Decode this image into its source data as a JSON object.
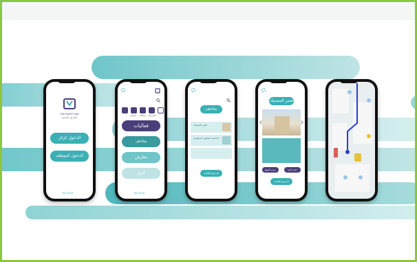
{
  "colors": {
    "frame": "#8cc63f",
    "teal": "#3ab0b5",
    "teal_light": "#b8e1e2",
    "purple": "#4a3f7a",
    "band": "#7ccccf"
  },
  "phone1": {
    "logo_name": "THE RIGHT WAY",
    "logo_sub": "الطريق الصحيح",
    "btn_visitor": "الدخول كزائر",
    "btn_employee": "الدخول كموظف",
    "footer": "RR 2016"
  },
  "phone2": {
    "categories": [
      "أسواق",
      "مواقف",
      "الخريطة",
      "",
      ""
    ],
    "btn_events": "فعاليات",
    "btn_museums": "متاحف",
    "btn_exhibits": "معارض",
    "btn_heritage": "آثري",
    "footer": "RR 2016"
  },
  "phone3": {
    "title": "متاحف",
    "item1": "قصر المصمك",
    "item2": "المتحف الوطني السعودي",
    "bottom_btn": "الرجوع للقائمة"
  },
  "phone4": {
    "title": "قصر المصمك",
    "btn_left": "عرض الموقع",
    "btn_right": "حجز تذكرة",
    "bottom_btn": "الرجوع للقائمة"
  },
  "phone5": {
    "map": "map-icon"
  }
}
